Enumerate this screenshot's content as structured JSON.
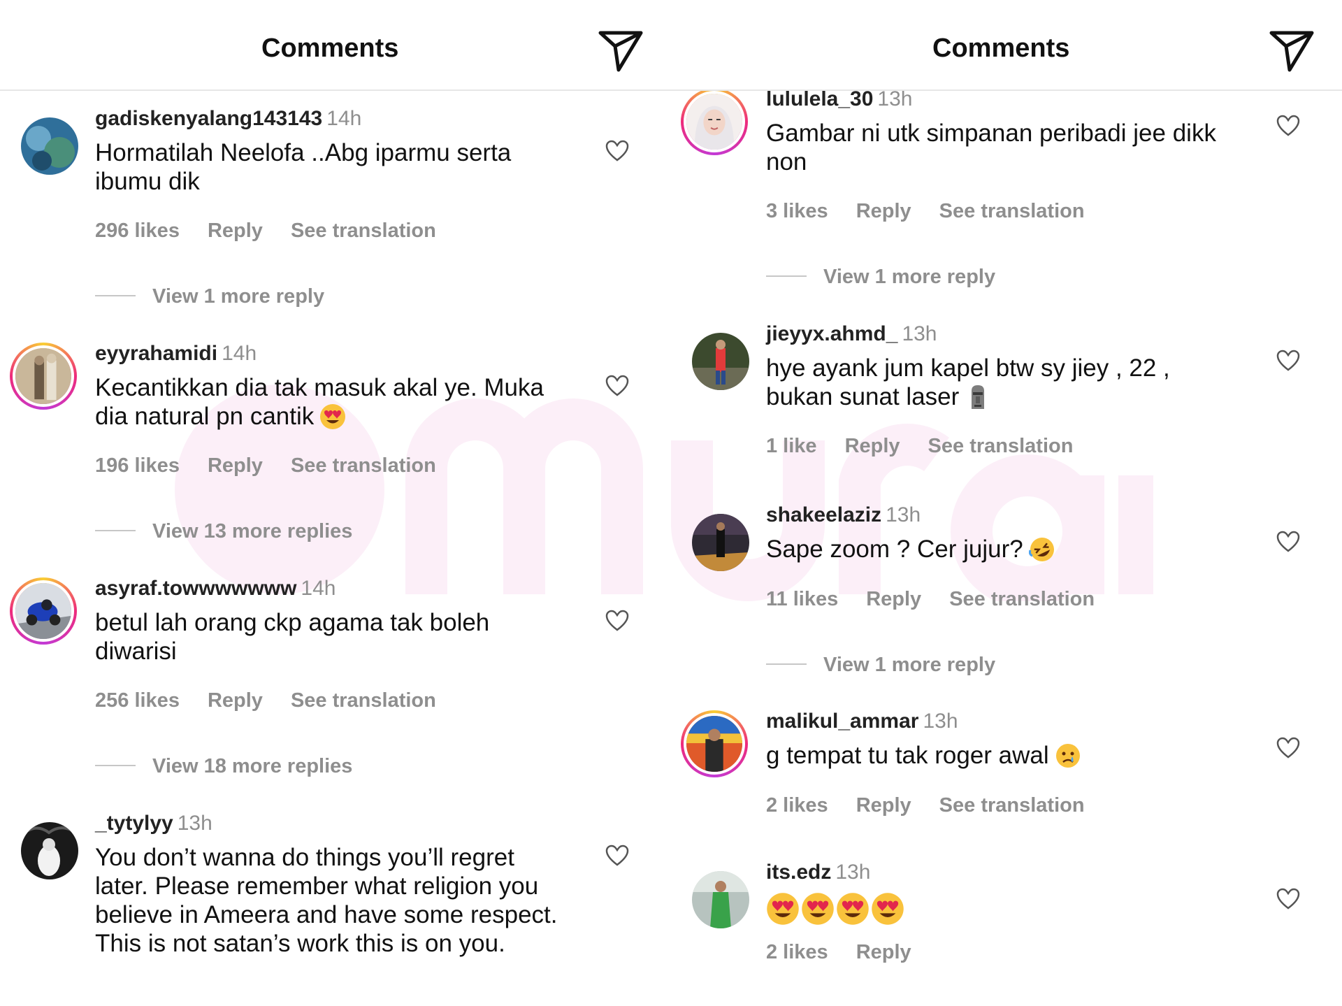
{
  "header": {
    "title": "Comments",
    "send_icon": "paper-plane-icon"
  },
  "colors": {
    "muted": "#8e8e8e",
    "story_ring": "#ee2a7b",
    "watermark": "#e880c8"
  },
  "left_comments": [
    {
      "username": "gadiskenyalang143143",
      "time": "14h",
      "text": "Hormatilah Neelofa ..Abg iparmu serta ibumu dik",
      "likes": "296 likes",
      "reply": "Reply",
      "translate": "See translation",
      "more": "View 1 more reply"
    },
    {
      "username": "eyyrahamidi",
      "time": "14h",
      "text": "Kecantikkan dia tak masuk akal ye. Muka dia natural pn cantik",
      "emoji": "heart-eyes-emoji",
      "likes": "196 likes",
      "reply": "Reply",
      "translate": "See translation",
      "more": "View 13 more replies"
    },
    {
      "username": "asyraf.towwwwwww",
      "time": "14h",
      "text": "betul lah orang ckp agama tak boleh diwarisi",
      "likes": "256 likes",
      "reply": "Reply",
      "translate": "See translation",
      "more": "View 18 more replies"
    },
    {
      "username": "_tytylyy",
      "time": "13h",
      "text": "You don’t wanna do things you’ll regret later. Please remember what religion you believe in Ameera and have some respect. This is not satan’s work this is on you."
    }
  ],
  "right_comments": [
    {
      "username": "lululela_30",
      "time": "13h",
      "text": "Gambar ni utk simpanan peribadi jee dikk non",
      "likes": "3 likes",
      "reply": "Reply",
      "translate": "See translation",
      "more": "View 1 more reply"
    },
    {
      "username": "jieyyx.ahmd_",
      "time": "13h",
      "text": "hye ayank jum kapel btw sy jiey , 22 , bukan sunat laser",
      "emoji": "moai-emoji",
      "likes": "1 like",
      "reply": "Reply",
      "translate": "See translation"
    },
    {
      "username": "shakeelaziz",
      "time": "13h",
      "text": "Sape zoom ? Cer jujur?",
      "emoji": "rofl-emoji",
      "likes": "11 likes",
      "reply": "Reply",
      "translate": "See translation",
      "more": "View 1 more reply"
    },
    {
      "username": "malikul_ammar",
      "time": "13h",
      "text": "g tempat tu tak roger awal",
      "emoji": "crying-face-emoji",
      "likes": "2 likes",
      "reply": "Reply",
      "translate": "See translation"
    },
    {
      "username": "its.edz",
      "time": "13h",
      "text": "",
      "emoji": "heart-eyes-emoji-x4",
      "likes": "2 likes",
      "reply": "Reply"
    }
  ]
}
